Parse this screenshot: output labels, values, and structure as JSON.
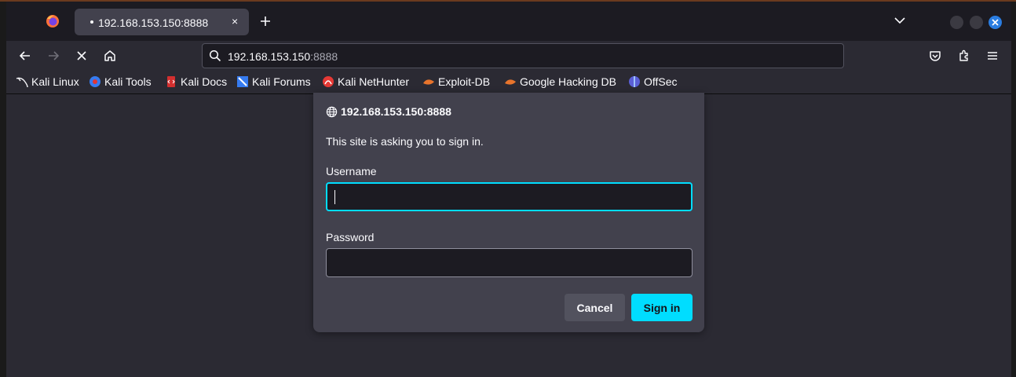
{
  "tab": {
    "title": "192.168.153.150:8888",
    "close": "×"
  },
  "urlbar": {
    "host": "192.168.153.150",
    "port": ":8888"
  },
  "bookmarks": [
    {
      "label": "Kali Linux",
      "icon": "kali-dragon-icon"
    },
    {
      "label": "Kali Tools",
      "icon": "kali-tools-icon"
    },
    {
      "label": "Kali Docs",
      "icon": "kali-docs-icon"
    },
    {
      "label": "Kali Forums",
      "icon": "kali-forums-icon"
    },
    {
      "label": "Kali NetHunter",
      "icon": "nethunter-icon"
    },
    {
      "label": "Exploit-DB",
      "icon": "exploit-db-icon"
    },
    {
      "label": "Google Hacking DB",
      "icon": "ghdb-icon"
    },
    {
      "label": "OffSec",
      "icon": "offsec-icon"
    }
  ],
  "dialog": {
    "host": "192.168.153.150:8888",
    "message": "This site is asking you to sign in.",
    "username_label": "Username",
    "username_value": "",
    "password_label": "Password",
    "password_value": "",
    "cancel_label": "Cancel",
    "signin_label": "Sign in"
  },
  "colors": {
    "accent": "#00ddff",
    "window_close": "#2a7de1",
    "toolbar": "#2b2a33",
    "dialog_bg": "#42414d"
  }
}
